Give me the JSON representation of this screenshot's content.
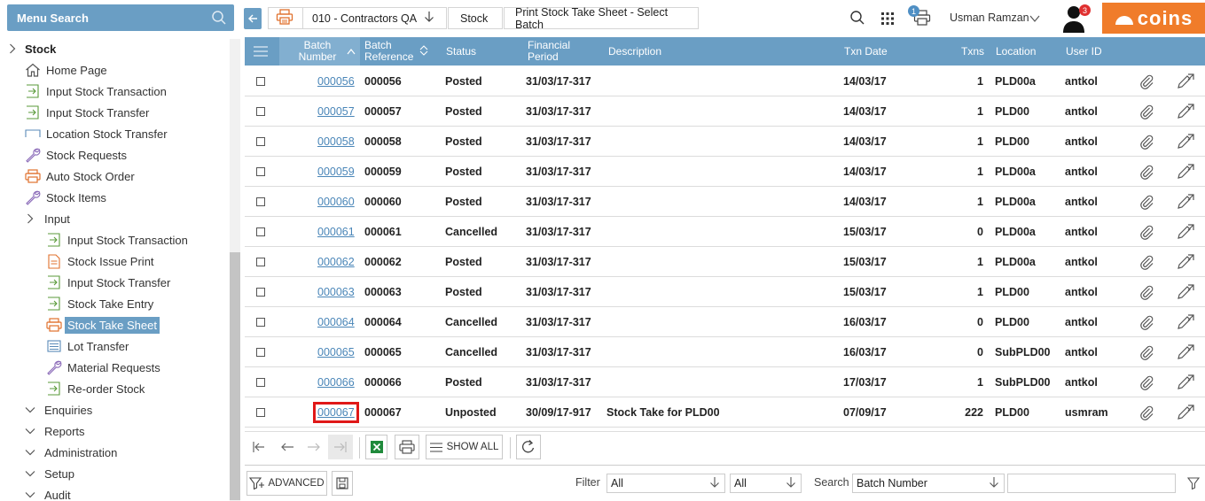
{
  "menu": {
    "search_label": "Menu Search"
  },
  "sidebar": {
    "items": [
      {
        "label": "Stock",
        "level": 0,
        "icon": "chevron-right-icon",
        "bold": true
      },
      {
        "label": "Home Page",
        "level": 1,
        "icon": "home-icon"
      },
      {
        "label": "Input Stock Transaction",
        "level": 1,
        "icon": "input-arrow-icon"
      },
      {
        "label": "Input Stock Transfer",
        "level": 1,
        "icon": "input-arrow-icon"
      },
      {
        "label": "Location Stock Transfer",
        "level": 1,
        "icon": "bracket-icon"
      },
      {
        "label": "Stock Requests",
        "level": 1,
        "icon": "wrench-icon"
      },
      {
        "label": "Auto Stock Order",
        "level": 1,
        "icon": "printer-icon"
      },
      {
        "label": "Stock Items",
        "level": 1,
        "icon": "wrench-icon"
      },
      {
        "label": "Input",
        "level": 1,
        "icon": "chevron-right-icon",
        "group": true
      },
      {
        "label": "Input Stock Transaction",
        "level": 2,
        "icon": "input-arrow-icon"
      },
      {
        "label": "Stock Issue Print",
        "level": 2,
        "icon": "document-icon"
      },
      {
        "label": "Input Stock Transfer",
        "level": 2,
        "icon": "input-arrow-icon"
      },
      {
        "label": "Stock Take Entry",
        "level": 2,
        "icon": "input-arrow-icon"
      },
      {
        "label": "Stock Take Sheet",
        "level": 2,
        "icon": "printer-icon",
        "selected": true
      },
      {
        "label": "Lot Transfer",
        "level": 2,
        "icon": "list-icon"
      },
      {
        "label": "Material Requests",
        "level": 2,
        "icon": "wrench-icon"
      },
      {
        "label": "Re-order Stock",
        "level": 2,
        "icon": "input-arrow-icon"
      },
      {
        "label": "Enquiries",
        "level": 1,
        "icon": "chevron-down-icon",
        "group": true
      },
      {
        "label": "Reports",
        "level": 1,
        "icon": "chevron-down-icon",
        "group": true
      },
      {
        "label": "Administration",
        "level": 1,
        "icon": "chevron-down-icon",
        "group": true
      },
      {
        "label": "Setup",
        "level": 1,
        "icon": "chevron-down-icon",
        "group": true
      },
      {
        "label": "Audit",
        "level": 1,
        "icon": "chevron-down-icon",
        "group": true
      }
    ]
  },
  "topbar": {
    "company": "010 - Contractors QA",
    "module": "Stock",
    "page": "Print Stock Take Sheet - Select Batch",
    "user": "Usman Ramzan",
    "print_badge": "1",
    "notification_badge": "3",
    "logo_text": "coins"
  },
  "grid": {
    "headers": {
      "batch_number": "Batch Number",
      "batch_reference": "Batch Reference",
      "status": "Status",
      "financial_period": "Financial Period",
      "description": "Description",
      "txn_date": "Txn Date",
      "txns": "Txns",
      "location": "Location",
      "user_id": "User ID"
    },
    "rows": [
      {
        "batch": "000056",
        "ref": "000056",
        "status": "Posted",
        "period": "31/03/17-317",
        "desc": "",
        "date": "14/03/17",
        "txns": "1",
        "loc": "PLD00a",
        "user": "antkol"
      },
      {
        "batch": "000057",
        "ref": "000057",
        "status": "Posted",
        "period": "31/03/17-317",
        "desc": "",
        "date": "14/03/17",
        "txns": "1",
        "loc": "PLD00",
        "user": "antkol"
      },
      {
        "batch": "000058",
        "ref": "000058",
        "status": "Posted",
        "period": "31/03/17-317",
        "desc": "",
        "date": "14/03/17",
        "txns": "1",
        "loc": "PLD00",
        "user": "antkol"
      },
      {
        "batch": "000059",
        "ref": "000059",
        "status": "Posted",
        "period": "31/03/17-317",
        "desc": "",
        "date": "14/03/17",
        "txns": "1",
        "loc": "PLD00a",
        "user": "antkol"
      },
      {
        "batch": "000060",
        "ref": "000060",
        "status": "Posted",
        "period": "31/03/17-317",
        "desc": "",
        "date": "14/03/17",
        "txns": "1",
        "loc": "PLD00a",
        "user": "antkol"
      },
      {
        "batch": "000061",
        "ref": "000061",
        "status": "Cancelled",
        "period": "31/03/17-317",
        "desc": "",
        "date": "15/03/17",
        "txns": "0",
        "loc": "PLD00a",
        "user": "antkol"
      },
      {
        "batch": "000062",
        "ref": "000062",
        "status": "Posted",
        "period": "31/03/17-317",
        "desc": "",
        "date": "15/03/17",
        "txns": "1",
        "loc": "PLD00a",
        "user": "antkol"
      },
      {
        "batch": "000063",
        "ref": "000063",
        "status": "Posted",
        "period": "31/03/17-317",
        "desc": "",
        "date": "15/03/17",
        "txns": "1",
        "loc": "PLD00",
        "user": "antkol"
      },
      {
        "batch": "000064",
        "ref": "000064",
        "status": "Cancelled",
        "period": "31/03/17-317",
        "desc": "",
        "date": "16/03/17",
        "txns": "0",
        "loc": "PLD00",
        "user": "antkol"
      },
      {
        "batch": "000065",
        "ref": "000065",
        "status": "Cancelled",
        "period": "31/03/17-317",
        "desc": "",
        "date": "16/03/17",
        "txns": "0",
        "loc": "SubPLD00",
        "user": "antkol"
      },
      {
        "batch": "000066",
        "ref": "000066",
        "status": "Posted",
        "period": "31/03/17-317",
        "desc": "",
        "date": "17/03/17",
        "txns": "1",
        "loc": "SubPLD00",
        "user": "antkol"
      },
      {
        "batch": "000067",
        "ref": "000067",
        "status": "Unposted",
        "period": "30/09/17-917",
        "desc": "Stock Take for PLD00",
        "date": "07/09/17",
        "txns": "222",
        "loc": "PLD00",
        "user": "usmram",
        "highlight": true
      }
    ]
  },
  "pager": {
    "show_all_label": "SHOW ALL"
  },
  "filterbar": {
    "advanced_label": "ADVANCED",
    "filter_label": "Filter",
    "filter1_value": "All",
    "filter2_value": "All",
    "search_label": "Search",
    "search_field": "Batch Number",
    "search_value": ""
  }
}
